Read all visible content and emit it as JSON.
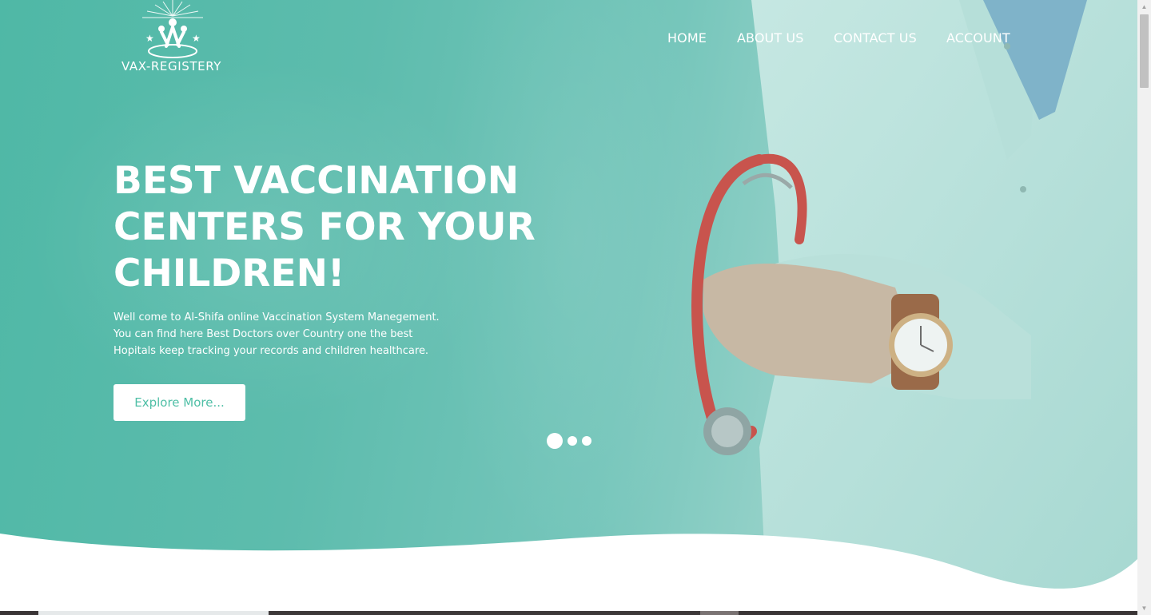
{
  "brand": {
    "name": "VAX-REGISTERY"
  },
  "nav": {
    "items": [
      "HOME",
      "ABOUT US",
      "CONTACT US",
      "ACCOUNT"
    ]
  },
  "hero": {
    "headline_lines": [
      "BEST VACCINATION",
      "CENTERS FOR YOUR",
      "CHILDREN!"
    ],
    "intro_lines": [
      "Well come to Al-Shifa online Vaccination System Manegement.",
      "You can find here Best Doctors over Country one the best",
      "Hopitals keep tracking your records and children healthcare."
    ],
    "cta_label": "Explore More...",
    "carousel": {
      "slide_count": 3,
      "active_slide": 1
    }
  },
  "colors": {
    "accent": "#4fbfa6",
    "hero_start": "#4fb8a6",
    "hero_end": "#a9d9d4",
    "text_light": "#ffffff"
  },
  "icons": {
    "logo": "family-sunburst-logo",
    "scroll_up": "scroll-up-arrow-icon",
    "scroll_down": "scroll-down-arrow-icon"
  }
}
